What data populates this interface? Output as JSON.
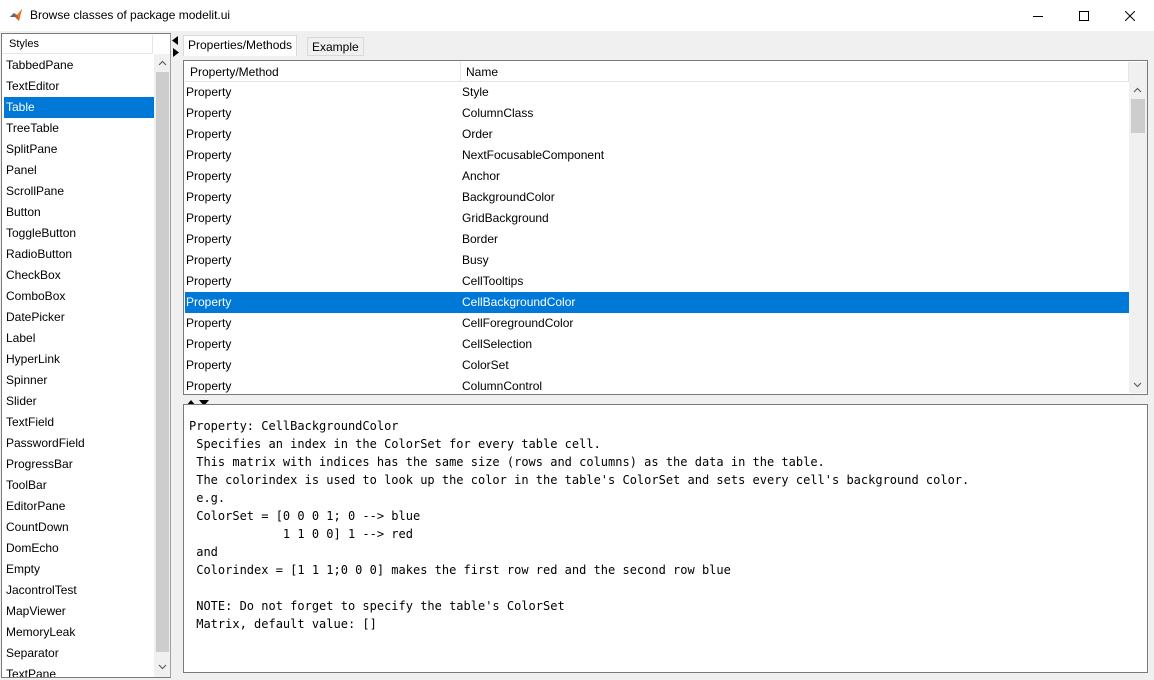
{
  "window": {
    "title": "Browse classes of package modelit.ui",
    "icon": "matlab-icon",
    "controls": [
      "minimize-icon",
      "maximize-icon",
      "close-icon"
    ]
  },
  "styles_list": {
    "header": "Styles",
    "items": [
      "TabbedPane",
      "TextEditor",
      "Table",
      "TreeTable",
      "SplitPane",
      "Panel",
      "ScrollPane",
      "Button",
      "ToggleButton",
      "RadioButton",
      "CheckBox",
      "ComboBox",
      "DatePicker",
      "Label",
      "HyperLink",
      "Spinner",
      "Slider",
      "TextField",
      "PasswordField",
      "ProgressBar",
      "ToolBar",
      "EditorPane",
      "CountDown",
      "DomEcho",
      "Empty",
      "JacontrolTest",
      "MapViewer",
      "MemoryLeak",
      "Separator",
      "TextPane"
    ],
    "selected": "Table"
  },
  "tabs": [
    {
      "label": "Properties/Methods",
      "active": true
    },
    {
      "label": "Example",
      "active": false
    }
  ],
  "table": {
    "columns": [
      "Property/Method",
      "Name"
    ],
    "rows": [
      [
        "Property",
        "Style"
      ],
      [
        "Property",
        "ColumnClass"
      ],
      [
        "Property",
        "Order"
      ],
      [
        "Property",
        "NextFocusableComponent"
      ],
      [
        "Property",
        "Anchor"
      ],
      [
        "Property",
        "BackgroundColor"
      ],
      [
        "Property",
        "GridBackground"
      ],
      [
        "Property",
        "Border"
      ],
      [
        "Property",
        "Busy"
      ],
      [
        "Property",
        "CellTooltips"
      ],
      [
        "Property",
        "CellBackgroundColor"
      ],
      [
        "Property",
        "CellForegroundColor"
      ],
      [
        "Property",
        "CellSelection"
      ],
      [
        "Property",
        "ColorSet"
      ],
      [
        "Property",
        "ColumnControl"
      ]
    ],
    "selected_row": 10
  },
  "description": {
    "lines": [
      "Property: CellBackgroundColor",
      " Specifies an index in the ColorSet for every table cell.",
      " This matrix with indices has the same size (rows and columns) as the data in the table.",
      " The colorindex is used to look up the color in the table's ColorSet and sets every cell's background color.",
      " e.g.",
      " ColorSet = [0 0 0 1; 0 --> blue",
      "             1 1 0 0] 1 --> red",
      " and",
      " Colorindex = [1 1 1;0 0 0] makes the first row red and the second row blue",
      "",
      " NOTE: Do not forget to specify the table's ColorSet",
      " Matrix, default value: []"
    ]
  },
  "colors": {
    "selection": "#0078d7",
    "frame": "#f0f0f0",
    "border": "#7a7a7a"
  }
}
